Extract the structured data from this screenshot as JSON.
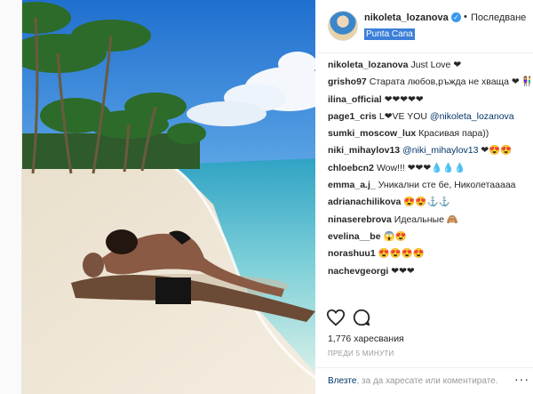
{
  "header": {
    "username": "nikoleta_lozanova",
    "dot": "•",
    "follow_label": "Последване",
    "location": "Punta Cana"
  },
  "comments": [
    {
      "user": "nikoleta_lozanova",
      "text": "Just Love ❤"
    },
    {
      "user": "grisho97",
      "text": "Старата любов,ръждa не хваща ❤ 👫"
    },
    {
      "user": "ilina_official",
      "text": "❤❤❤❤❤"
    },
    {
      "user": "page1_cris",
      "text": "L❤VE YOU ",
      "mention": "@nikoleta_lozanova"
    },
    {
      "user": "sumki_moscow_lux",
      "text": "Красивая пара))"
    },
    {
      "user": "niki_mihaylov13",
      "text": " ❤😍😍",
      "mention": "@niki_mihaylov13"
    },
    {
      "user": "chloebcn2",
      "text": "Wow!!! ❤❤❤💧💧💧"
    },
    {
      "user": "emma_a.j_",
      "text": "Уникални сте бе, Николетааааа"
    },
    {
      "user": "adrianachilikova",
      "text": "😍😍⚓⚓"
    },
    {
      "user": "ninaserebrova",
      "text": "Идеальные 🙈"
    },
    {
      "user": "evelina__be",
      "text": "😱😍"
    },
    {
      "user": "norashuu1",
      "text": "😍😍😍😍"
    },
    {
      "user": "nachevgeorgi",
      "text": "❤❤❤"
    }
  ],
  "likes": "1,776 харесвания",
  "time": "ПРЕДИ 5 МИНУТИ",
  "login": {
    "link": "Влезте",
    "rest": ", за да харесате или коментирате.",
    "more": "···"
  },
  "icons": {
    "heart": "heart-outline-icon",
    "comment": "speech-bubble-icon",
    "verified": "verified-badge-icon",
    "more": "more-options-icon"
  },
  "colors": {
    "verified": "#3897f0",
    "location_highlight": "#3b7fd9",
    "link": "#003569"
  }
}
